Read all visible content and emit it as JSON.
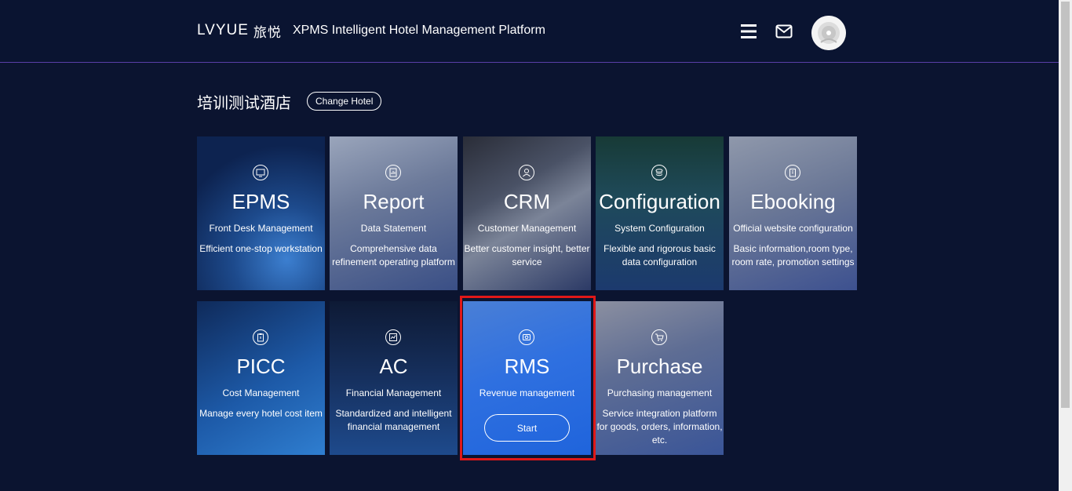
{
  "header": {
    "logo_latin": "LVYUE",
    "logo_cn": "旅悦",
    "title": "XPMS Intelligent Hotel Management Platform",
    "menu_icon": "hamburger-menu-icon",
    "mail_icon": "mail-icon",
    "avatar_icon": "user-avatar"
  },
  "hotel": {
    "name": "培训测试酒店",
    "change_label": "Change Hotel"
  },
  "tiles": [
    {
      "title": "EPMS",
      "subtitle": "Front Desk Management",
      "description": "Efficient one-stop workstation",
      "icon": "monitor-icon"
    },
    {
      "title": "Report",
      "subtitle": "Data Statement",
      "description": "Comprehensive data refinement operating platform",
      "icon": "report-icon"
    },
    {
      "title": "CRM",
      "subtitle": "Customer Management",
      "description": "Better customer insight, better service",
      "icon": "customer-icon"
    },
    {
      "title": "Configuration",
      "subtitle": "System Configuration",
      "description": "Flexible and rigorous basic data configuration",
      "icon": "layers-icon"
    },
    {
      "title": "Ebooking",
      "subtitle": "Official website configuration",
      "description": "Basic information,room type, room rate, promotion settings",
      "icon": "building-icon"
    },
    {
      "title": "PICC",
      "subtitle": "Cost Management",
      "description": "Manage every hotel cost item",
      "icon": "clipboard-icon"
    },
    {
      "title": "AC",
      "subtitle": "Financial Management",
      "description": "Standardized and intelligent financial management",
      "icon": "chart-icon"
    },
    {
      "title": "RMS",
      "subtitle": "Revenue management",
      "description": "",
      "icon": "revenue-icon",
      "action": "Start"
    },
    {
      "title": "Purchase",
      "subtitle": "Purchasing management",
      "description": "Service integration platform for goods, orders, information, etc.",
      "icon": "cart-icon"
    }
  ],
  "colors": {
    "background": "#0b1430",
    "header_border": "#5a3fa8",
    "active_tile": "#2a78e8",
    "highlight_border": "#e01818"
  }
}
